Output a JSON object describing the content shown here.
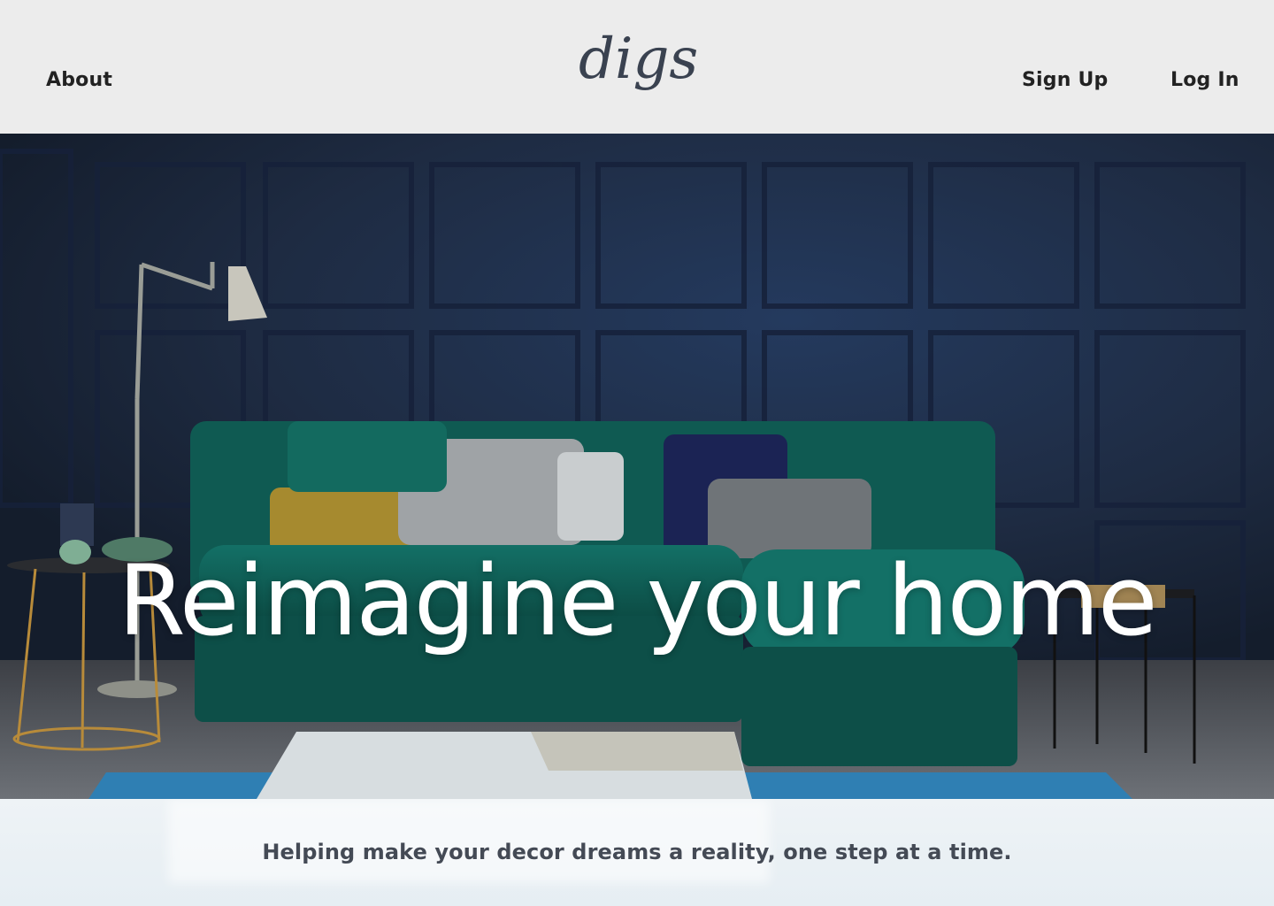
{
  "header": {
    "logo_text": "digs",
    "nav_left": [
      "About"
    ],
    "nav_right": [
      "Sign Up",
      "Log In"
    ]
  },
  "hero": {
    "title": "Reimagine your home",
    "image_description_icon": "living-room-photo"
  },
  "band": {
    "tagline": "Helping make your decor dreams a reality, one step at a time."
  },
  "colors": {
    "header_bg": "#ececec",
    "wall": "#1f2c43",
    "sofa": "#0f5a52",
    "title_text": "#ffffff",
    "tagline_text": "#444a55"
  }
}
